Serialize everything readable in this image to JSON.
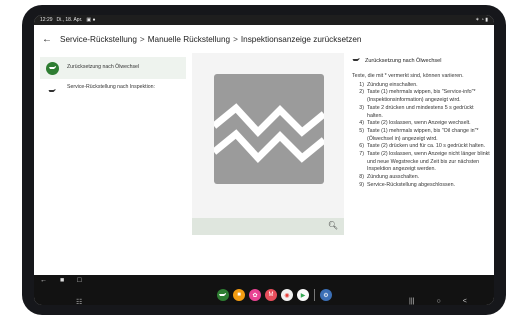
{
  "statusbar": {
    "time": "12:29",
    "date": "Di., 18. Apr.",
    "left_icons": "▣ ●",
    "right_icons": "✶ ◔ ▮"
  },
  "header": {
    "crumbs": [
      "Service-Rückstellung",
      "Manuelle Rückstellung",
      "Inspektionsanzeige zurücksetzen"
    ],
    "separator": ">"
  },
  "sidebar": {
    "items": [
      {
        "label": "Zurücksetzung nach Ölwechsel",
        "icon": "oil-can-icon"
      },
      {
        "label": "Service-Rückstellung nach Inspektion:",
        "icon": "oil-can-icon"
      }
    ]
  },
  "content": {
    "title": "Zurücksetzung nach Ölwechsel",
    "intro": "Texte, die mit * vermerkt sind, können variieren.",
    "steps": [
      {
        "n": "1)",
        "text": "Zündung einschalten."
      },
      {
        "n": "2)",
        "text": "Taste (1) mehrmals wippen, bis \"Service-info\"* (Inspektionsinformation) angezeigt wird."
      },
      {
        "n": "3)",
        "text": "Taste 2 drücken und mindestens 5 s gedrückt halten."
      },
      {
        "n": "4)",
        "text": "Taste (2) loslassen, wenn Anzeige wechselt."
      },
      {
        "n": "5)",
        "text": "Taste (1) mehrmals wippen, bis \"Oil change in\"* (Ölwechsel in) angezeigt wird."
      },
      {
        "n": "6)",
        "text": "Taste (2) drücken und für ca. 10 s gedrückt halten."
      },
      {
        "n": "7)",
        "text": "Taste (2) loslassen, wenn Anzeige nicht länger blinkt und neue Wegstrecke und Zeit bis zur nächsten Inspektion angezeigt werden."
      },
      {
        "n": "8)",
        "text": "Zündung ausschalten."
      },
      {
        "n": "9)",
        "text": "Service-Rückstellung abgeschlossen."
      }
    ]
  },
  "image_panel": {
    "icon": "broken-image-icon",
    "zoom_icon": "zoom-icon"
  },
  "colors": {
    "accent": "#2e7d32",
    "placeholder_gray": "#9b9b9b",
    "search_bar": "#dfe6de",
    "active_item_bg": "#eef3ee"
  },
  "navbar": {
    "top_icons": [
      "←",
      "■",
      "□"
    ],
    "apps_grid": "☷",
    "sys": [
      "|||",
      "○",
      "<"
    ]
  }
}
